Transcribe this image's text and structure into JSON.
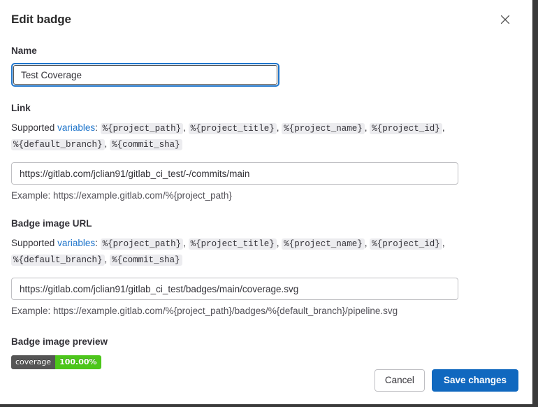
{
  "modal": {
    "title": "Edit badge",
    "close_icon": "close-icon"
  },
  "name_field": {
    "label": "Name",
    "value": "Test Coverage",
    "placeholder": ""
  },
  "link_field": {
    "label": "Link",
    "supported_prefix": "Supported ",
    "supported_link": "variables",
    "supported_colon": ": ",
    "variables": [
      "%{project_path}",
      "%{project_title}",
      "%{project_name}",
      "%{default_branch}",
      "%{project_id}",
      "%{commit_sha}"
    ],
    "variables_display_order": [
      "%{project_path}",
      "%{project_title}",
      "%{project_name}",
      "%{project_id}",
      "%{default_branch}",
      "%{commit_sha}"
    ],
    "value": "https://gitlab.com/jclian91/gitlab_ci_test/-/commits/main",
    "placeholder": "",
    "example": "Example: https://example.gitlab.com/%{project_path}"
  },
  "image_url_field": {
    "label": "Badge image URL",
    "supported_prefix": "Supported ",
    "supported_link": "variables",
    "supported_colon": ": ",
    "value": "https://gitlab.com/jclian91/gitlab_ci_test/badges/main/coverage.svg",
    "placeholder": "",
    "example": "Example: https://example.gitlab.com/%{project_path}/badges/%{default_branch}/pipeline.svg"
  },
  "preview": {
    "label": "Badge image preview",
    "badge_left_text": "coverage",
    "badge_right_text": "100.00%",
    "badge_left_color": "#555555",
    "badge_right_color": "#4cc61a"
  },
  "footer": {
    "cancel_label": "Cancel",
    "save_label": "Save changes",
    "primary_color": "#1068bf"
  },
  "var_chips": {
    "v1": "%{project_path}",
    "v2": "%{project_title}",
    "v3": "%{project_name}",
    "v4": "%{project_id}",
    "v5": "%{default_branch}",
    "v6": "%{commit_sha}"
  },
  "punct": {
    "comma": ",",
    "colon": ":"
  }
}
